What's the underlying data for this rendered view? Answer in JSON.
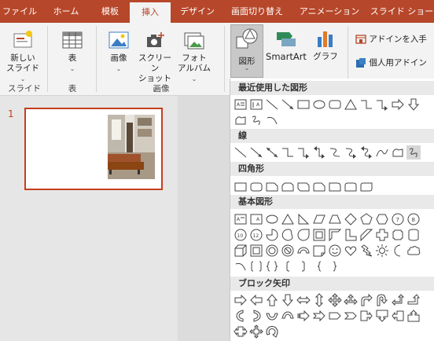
{
  "tabs": [
    "ファイル",
    "ホーム",
    "模板",
    "挿入",
    "デザイン",
    "画面切り替え",
    "アニメーション",
    "スライド ショー"
  ],
  "active_tab": "挿入",
  "ribbon": {
    "new_slide": {
      "line1": "新しい",
      "line2": "スライド"
    },
    "group_slides": "スライド",
    "table": "表",
    "group_table": "表",
    "image": "画像",
    "screenshot": {
      "line1": "スクリーン",
      "line2": "ショット"
    },
    "photo_album": {
      "line1": "フォト",
      "line2": "アルバム"
    },
    "group_images": "画像",
    "shapes": "図形",
    "smartart": "SmartArt",
    "chart": "グラフ",
    "get_addins": "アドインを入手",
    "my_addins": "個人用アドイン"
  },
  "slide_panel": {
    "slide_number": "1"
  },
  "gallery": {
    "sections": {
      "recent": "最近使用した図形",
      "lines": "線",
      "rectangles": "四角形",
      "basic": "基本図形",
      "block_arrows": "ブロック矢印"
    }
  },
  "colors": {
    "accent": "#b7472a",
    "selected_border": "#c43e1c"
  }
}
